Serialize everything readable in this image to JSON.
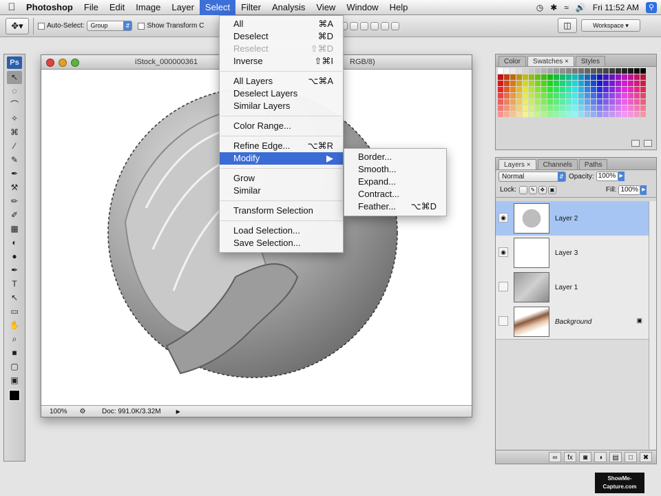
{
  "menubar": {
    "app": "Photoshop",
    "items": [
      "File",
      "Edit",
      "Image",
      "Layer",
      "Select",
      "Filter",
      "Analysis",
      "View",
      "Window",
      "Help"
    ],
    "active": "Select",
    "clock": "Fri 11:52 AM"
  },
  "options": {
    "auto_select": "Auto-Select:",
    "group_value": "Group",
    "show_transform": "Show Transform C",
    "workspace": "Workspace ▾"
  },
  "tools": {
    "badge": "Ps",
    "icons": [
      "↖",
      "◌",
      "⌒",
      "✧",
      "⌘",
      "⁄",
      "✎",
      "✒",
      "⚒",
      "✏",
      "✐",
      "▦",
      "◐",
      "●",
      "✒",
      "T",
      "↖",
      "▭",
      "✋",
      "⌕",
      "■",
      "▢",
      "▣"
    ]
  },
  "document": {
    "title_left": "iStock_000000361",
    "title_right": "RGB/8)",
    "zoom": "100%",
    "doc_info": "Doc: 991.0K/3.32M"
  },
  "select_menu": {
    "items": [
      {
        "label": "All",
        "shortcut": "⌘A"
      },
      {
        "label": "Deselect",
        "shortcut": "⌘D"
      },
      {
        "label": "Reselect",
        "shortcut": "⇧⌘D",
        "disabled": true
      },
      {
        "label": "Inverse",
        "shortcut": "⇧⌘I"
      },
      {
        "sep": true
      },
      {
        "label": "All Layers",
        "shortcut": "⌥⌘A"
      },
      {
        "label": "Deselect Layers",
        "shortcut": ""
      },
      {
        "label": "Similar Layers",
        "shortcut": ""
      },
      {
        "sep": true
      },
      {
        "label": "Color Range...",
        "shortcut": ""
      },
      {
        "sep": true
      },
      {
        "label": "Refine Edge...",
        "shortcut": "⌥⌘R"
      },
      {
        "label": "Modify",
        "shortcut": "▶",
        "highlighted": true
      },
      {
        "sep": true
      },
      {
        "label": "Grow",
        "shortcut": ""
      },
      {
        "label": "Similar",
        "shortcut": ""
      },
      {
        "sep": true
      },
      {
        "label": "Transform Selection",
        "shortcut": ""
      },
      {
        "sep": true
      },
      {
        "label": "Load Selection...",
        "shortcut": ""
      },
      {
        "label": "Save Selection...",
        "shortcut": ""
      }
    ]
  },
  "modify_submenu": {
    "items": [
      {
        "label": "Border...",
        "shortcut": ""
      },
      {
        "label": "Smooth...",
        "shortcut": ""
      },
      {
        "label": "Expand...",
        "shortcut": ""
      },
      {
        "label": "Contract...",
        "shortcut": ""
      },
      {
        "label": "Feather...",
        "shortcut": "⌥⌘D"
      }
    ]
  },
  "swatches_panel": {
    "tabs": [
      "Color",
      "Swatches ×",
      "Styles"
    ],
    "active_tab": "Swatches ×"
  },
  "layers_panel": {
    "tabs": [
      "Layers ×",
      "Channels",
      "Paths"
    ],
    "active_tab": "Layers ×",
    "blend_mode": "Normal",
    "opacity_label": "Opacity:",
    "opacity_value": "100%",
    "lock_label": "Lock:",
    "fill_label": "Fill:",
    "fill_value": "100%",
    "layers": [
      {
        "name": "Layer 2",
        "visible": true,
        "selected": true
      },
      {
        "name": "Layer 3",
        "visible": true,
        "selected": false
      },
      {
        "name": "Layer 1",
        "visible": false,
        "selected": false
      },
      {
        "name": "Background",
        "visible": false,
        "selected": false,
        "locked": true
      }
    ],
    "footer_icons": [
      "link-icon",
      "fx-icon",
      "mask-icon",
      "adjustment-icon",
      "folder-icon",
      "new-layer-icon",
      "trash-icon"
    ]
  },
  "watermark": "ShowMe-\nCapture.com"
}
